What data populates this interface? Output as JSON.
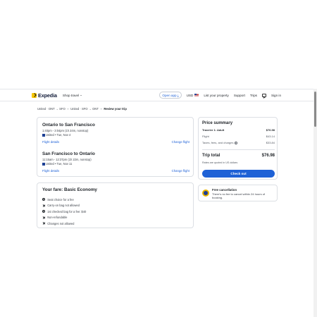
{
  "header": {
    "logo_text": "Expedia",
    "shop_travel": "Shop travel",
    "get_app": "Open app",
    "currency": "USD",
    "list_property": "List your property",
    "support": "Support",
    "trips": "Trips",
    "sign_in": "Sign in"
  },
  "breadcrumb": {
    "items": [
      "United · ONT → SFO",
      "United · SFO → ONT"
    ],
    "current": "Review your trip"
  },
  "flights": [
    {
      "title": "Ontario to San Francisco",
      "time": "1:40pm - 3:04pm (1h 24m, nonstop)",
      "carrier": "United • Tue, Nov 4",
      "details_link": "Flight details",
      "change_link": "Change flight"
    },
    {
      "title": "San Francisco to Ontario",
      "time": "11:15am - 12:37pm (1h 22m, nonstop)",
      "carrier": "United • Tue, Nov 11",
      "details_link": "Flight details",
      "change_link": "Change flight"
    }
  ],
  "fare": {
    "title": "Your fare: Basic Economy",
    "items": [
      {
        "icon": "seat-icon",
        "text": "Seat choice for a fee"
      },
      {
        "icon": "close-icon",
        "text": "Carry-on bag not allowed"
      },
      {
        "icon": "bag-icon",
        "text": "1st checked bag for a fee: $40"
      },
      {
        "icon": "close-icon",
        "text": "Non-refundable"
      },
      {
        "icon": "close-icon",
        "text": "Changes not allowed"
      }
    ]
  },
  "price_summary": {
    "title": "Price summary",
    "traveler_label": "Traveler 1: Adult",
    "traveler_amount": "$76.98",
    "flight_label": "Flight",
    "flight_amount": "$43.14",
    "taxes_label": "Taxes, fees, and charges",
    "taxes_amount": "$33.84",
    "total_label": "Trip total",
    "total_amount": "$76.98",
    "rates_note": "Rates are quoted in US dollars",
    "checkout_label": "Check out"
  },
  "cancellation": {
    "title": "Free cancellation",
    "text": "There's no fee to cancel within 24 hours of booking."
  },
  "colors": {
    "accent": "#1e61d6",
    "logo": "#f7c600"
  }
}
